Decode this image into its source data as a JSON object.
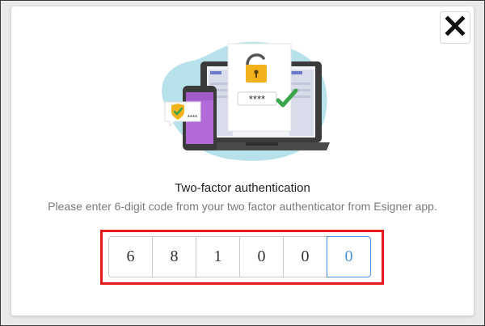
{
  "dialog": {
    "close_icon": "close-x-icon",
    "title": "Two-factor authentication",
    "subtitle": "Please enter 6-digit code from your two factor authenticator from Esigner app.",
    "illustration": {
      "screen_password_mask": "****",
      "phone_password_mask": "****"
    },
    "otp": {
      "digits": [
        "6",
        "8",
        "1",
        "0",
        "0",
        "0"
      ],
      "active_index": 5
    }
  },
  "colors": {
    "highlight_border": "#e51b1b",
    "active_cell_border": "#4a90e2",
    "blob": "#b7e2ec",
    "check": "#3aa54a",
    "lock": "#f2b21b"
  }
}
